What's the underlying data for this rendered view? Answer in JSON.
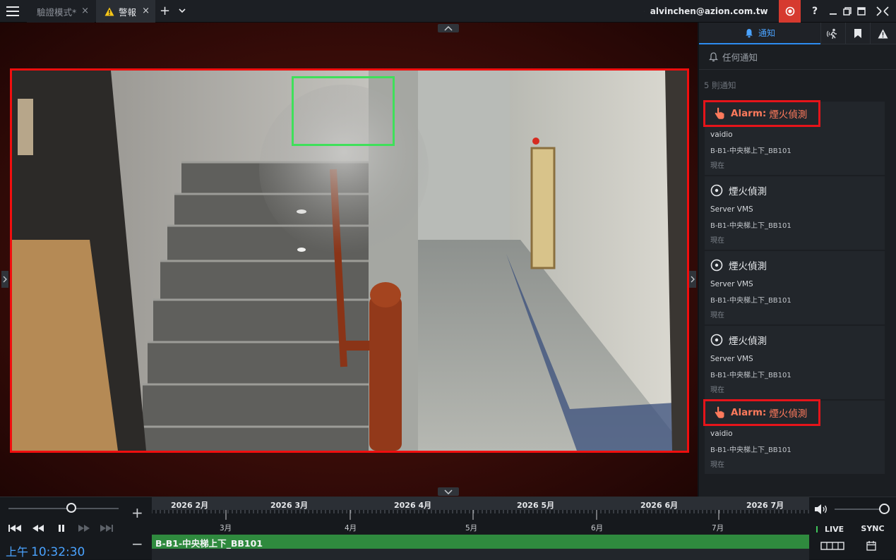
{
  "tabs": [
    {
      "label": "驗證模式*",
      "close": "×"
    },
    {
      "label": "警報",
      "close": "×"
    }
  ],
  "tab_add": "+",
  "account": {
    "email": "alvinchen@azion.com.tw"
  },
  "topbar_icons": [
    "record-icon",
    "help-icon",
    "minimize-icon",
    "restore-icon",
    "fullscreen-exit-icon"
  ],
  "help_glyph": "?",
  "panel": {
    "tab_notify": "通知",
    "filter_label": "任何通知",
    "count_label": "5 則通知",
    "notifications": [
      {
        "kind": "alarm",
        "prefix": "Alarm:",
        "title": "煙火偵測",
        "source": "vaidio",
        "location": "B-B1-中央梯上下_BB101",
        "time": "現在"
      },
      {
        "kind": "event",
        "prefix": "",
        "title": "煙火偵測",
        "source": "Server VMS",
        "location": "B-B1-中央梯上下_BB101",
        "time": "現在"
      },
      {
        "kind": "event",
        "prefix": "",
        "title": "煙火偵測",
        "source": "Server VMS",
        "location": "B-B1-中央梯上下_BB101",
        "time": "現在"
      },
      {
        "kind": "event",
        "prefix": "",
        "title": "煙火偵測",
        "source": "Server VMS",
        "location": "B-B1-中央梯上下_BB101",
        "time": "現在"
      },
      {
        "kind": "alarm",
        "prefix": "Alarm:",
        "title": "煙火偵測",
        "source": "vaidio",
        "location": "B-B1-中央梯上下_BB101",
        "time": "現在"
      }
    ]
  },
  "timeline": {
    "months_top": [
      "2026 2月",
      "2026 3月",
      "2026 4月",
      "2026 5月",
      "2026 6月",
      "2026 7月"
    ],
    "months_ruler": [
      "3月",
      "4月",
      "5月",
      "6月",
      "7月"
    ],
    "track_label": "B-B1-中央梯上下_BB101",
    "zoom_in": "+",
    "zoom_out": "−",
    "clock_ampm": "上午",
    "clock_time": "10:32:30",
    "live_label": "LIVE",
    "sync_label": "SYNC",
    "speed_level": 0.57,
    "volume_level": 1.0
  },
  "colors": {
    "accent": "#2d8cf0",
    "alarm_red": "#e5141a",
    "alarm_text": "#ff7a5c",
    "detect_green": "#3fe05a",
    "record_red": "#d63a2f",
    "track_green": "#2f8a3e"
  }
}
